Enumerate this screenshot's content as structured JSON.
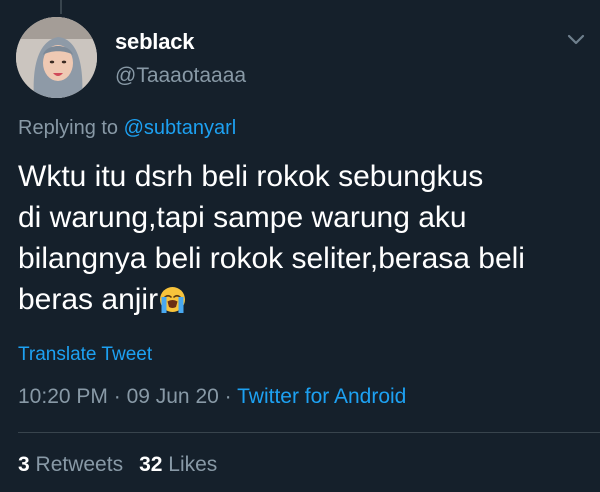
{
  "author": {
    "display_name": "seblack",
    "handle": "@Taaaotaaaa"
  },
  "menu": {
    "icon": "chevron-down-icon"
  },
  "reply": {
    "prefix": "Replying to",
    "mention": "@subtanyarl"
  },
  "tweet": {
    "text": "Wktu itu dsrh beli rokok sebungkus\ndi warung,tapi sampe warung aku\nbilangnya beli rokok seliter,berasa beli\nberas anjir",
    "emoji": "loudly-crying-face-emoji"
  },
  "translate_label": "Translate Tweet",
  "meta": {
    "time": "10:20 PM",
    "separator": " · ",
    "date": "09 Jun 20",
    "source": "Twitter for Android"
  },
  "stats": {
    "retweets_count": "3",
    "retweets_label": "Retweets",
    "likes_count": "32",
    "likes_label": "Likes"
  },
  "colors": {
    "background": "#15202b",
    "accent": "#1da1f2",
    "secondary_text": "#8899a6",
    "divider": "#38444d"
  }
}
